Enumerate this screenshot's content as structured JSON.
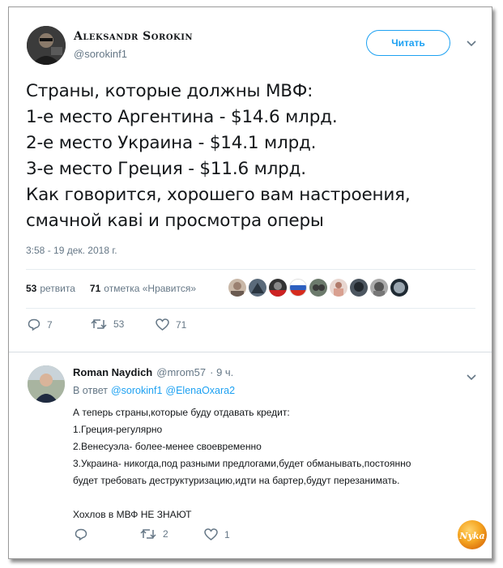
{
  "tweet": {
    "author_name": "Aleksandr Sorokin",
    "author_handle": "@sorokinf1",
    "follow_label": "Читать",
    "text_lines": [
      "Страны, которые должны МВФ:",
      "1-е место Аргентина - $14.6 млрд.",
      "2-е место Украина - $14.1 млрд.",
      "3-е место Греция - $11.6 млрд.",
      "Как говорится, хорошего вам настроения,",
      "смачной каві и просмотра оперы"
    ],
    "timestamp": "3:58 - 19 дек. 2018 г.",
    "retweets_count": "53",
    "retweets_label": "ретвита",
    "likes_count": "71",
    "likes_label": "отметка «Нравится»",
    "actions": {
      "replies": "7",
      "retweets": "53",
      "likes": "71"
    }
  },
  "reply": {
    "author_name": "Roman Naydich",
    "author_handle": "@mrom57",
    "time": "· 9 ч.",
    "in_reply_prefix": "В ответ",
    "in_reply_to_1": "@sorokinf1",
    "in_reply_to_2": "@ElenaOxara2",
    "text_lines": [
      "А теперь страны,которые буду отдавать кредит:",
      "1.Греция-регулярно",
      "2.Венесуэла- более-менее своевременно",
      "3.Украина- никогда,под разными предлогами,будет обманывать,постоянно",
      "будет требовать деструктуризацию,идти на бартер,будут перезанимать.",
      "",
      "Хохлов в МВФ НЕ ЗНАЮТ"
    ],
    "actions": {
      "replies": "",
      "retweets": "2",
      "likes": "1"
    }
  },
  "watermark": "Nyka",
  "colors": {
    "accent": "#1da1f2",
    "muted": "#657786",
    "text": "#14171a",
    "divider": "#e6ecf0"
  }
}
